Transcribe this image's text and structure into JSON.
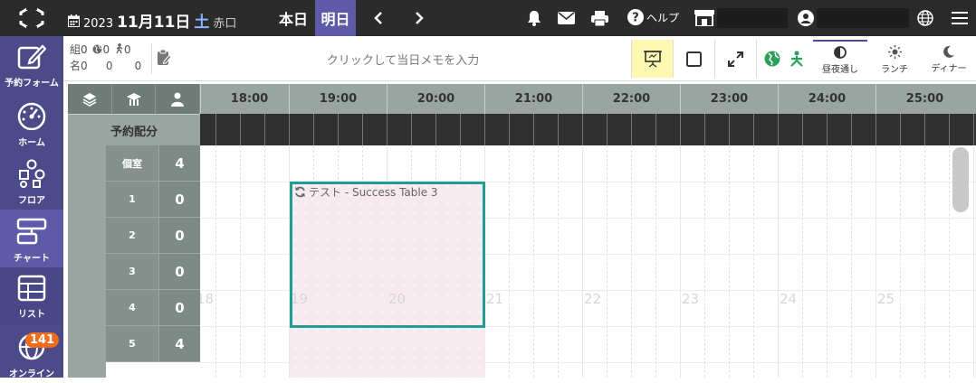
{
  "header": {
    "year": "2023",
    "month_day": "11月11日",
    "weekday": "土",
    "rokuyo": "赤口",
    "today_label": "本日",
    "tomorrow_label": "明日",
    "help_label": "ヘルプ",
    "accent_color": "#5e5aa8"
  },
  "sidebar": {
    "items": [
      {
        "label": "予約フォーム",
        "icon": "edit-icon"
      },
      {
        "label": "ホーム",
        "icon": "dashboard-icon"
      },
      {
        "label": "フロア",
        "icon": "floor-icon"
      },
      {
        "label": "チャート",
        "icon": "chart-icon"
      },
      {
        "label": "リスト",
        "icon": "table-icon"
      },
      {
        "label": "オンライン",
        "icon": "globe-icon"
      }
    ],
    "online_badge": "141"
  },
  "toolbar": {
    "counts": {
      "groups_label": "組",
      "people_label": "名",
      "groups_total": "0",
      "groups_web": "0",
      "groups_walkin": "0",
      "people_total": "0",
      "people_web": "0",
      "people_walkin": "0"
    },
    "memo_placeholder": "クリックして当日メモを入力",
    "modes": [
      {
        "label": "昼夜通し",
        "icon": "half-circle-icon"
      },
      {
        "label": "ランチ",
        "icon": "sun-icon"
      },
      {
        "label": "ディナー",
        "icon": "moon-icon"
      }
    ]
  },
  "timeline": {
    "hours": [
      "18:00",
      "19:00",
      "20:00",
      "21:00",
      "22:00",
      "23:00",
      "24:00",
      "25:00"
    ],
    "watermarks": [
      "18",
      "19",
      "20",
      "21",
      "22",
      "23",
      "24",
      "25"
    ],
    "allocation_label": "予約配分"
  },
  "rows": [
    {
      "name": "個室",
      "count": "4"
    },
    {
      "name": "1",
      "count": "0"
    },
    {
      "name": "2",
      "count": "0"
    },
    {
      "name": "3",
      "count": "0"
    },
    {
      "name": "4",
      "count": "0"
    },
    {
      "name": "5",
      "count": "4"
    }
  ],
  "reservation": {
    "label": "テスト - Success Table 3"
  }
}
